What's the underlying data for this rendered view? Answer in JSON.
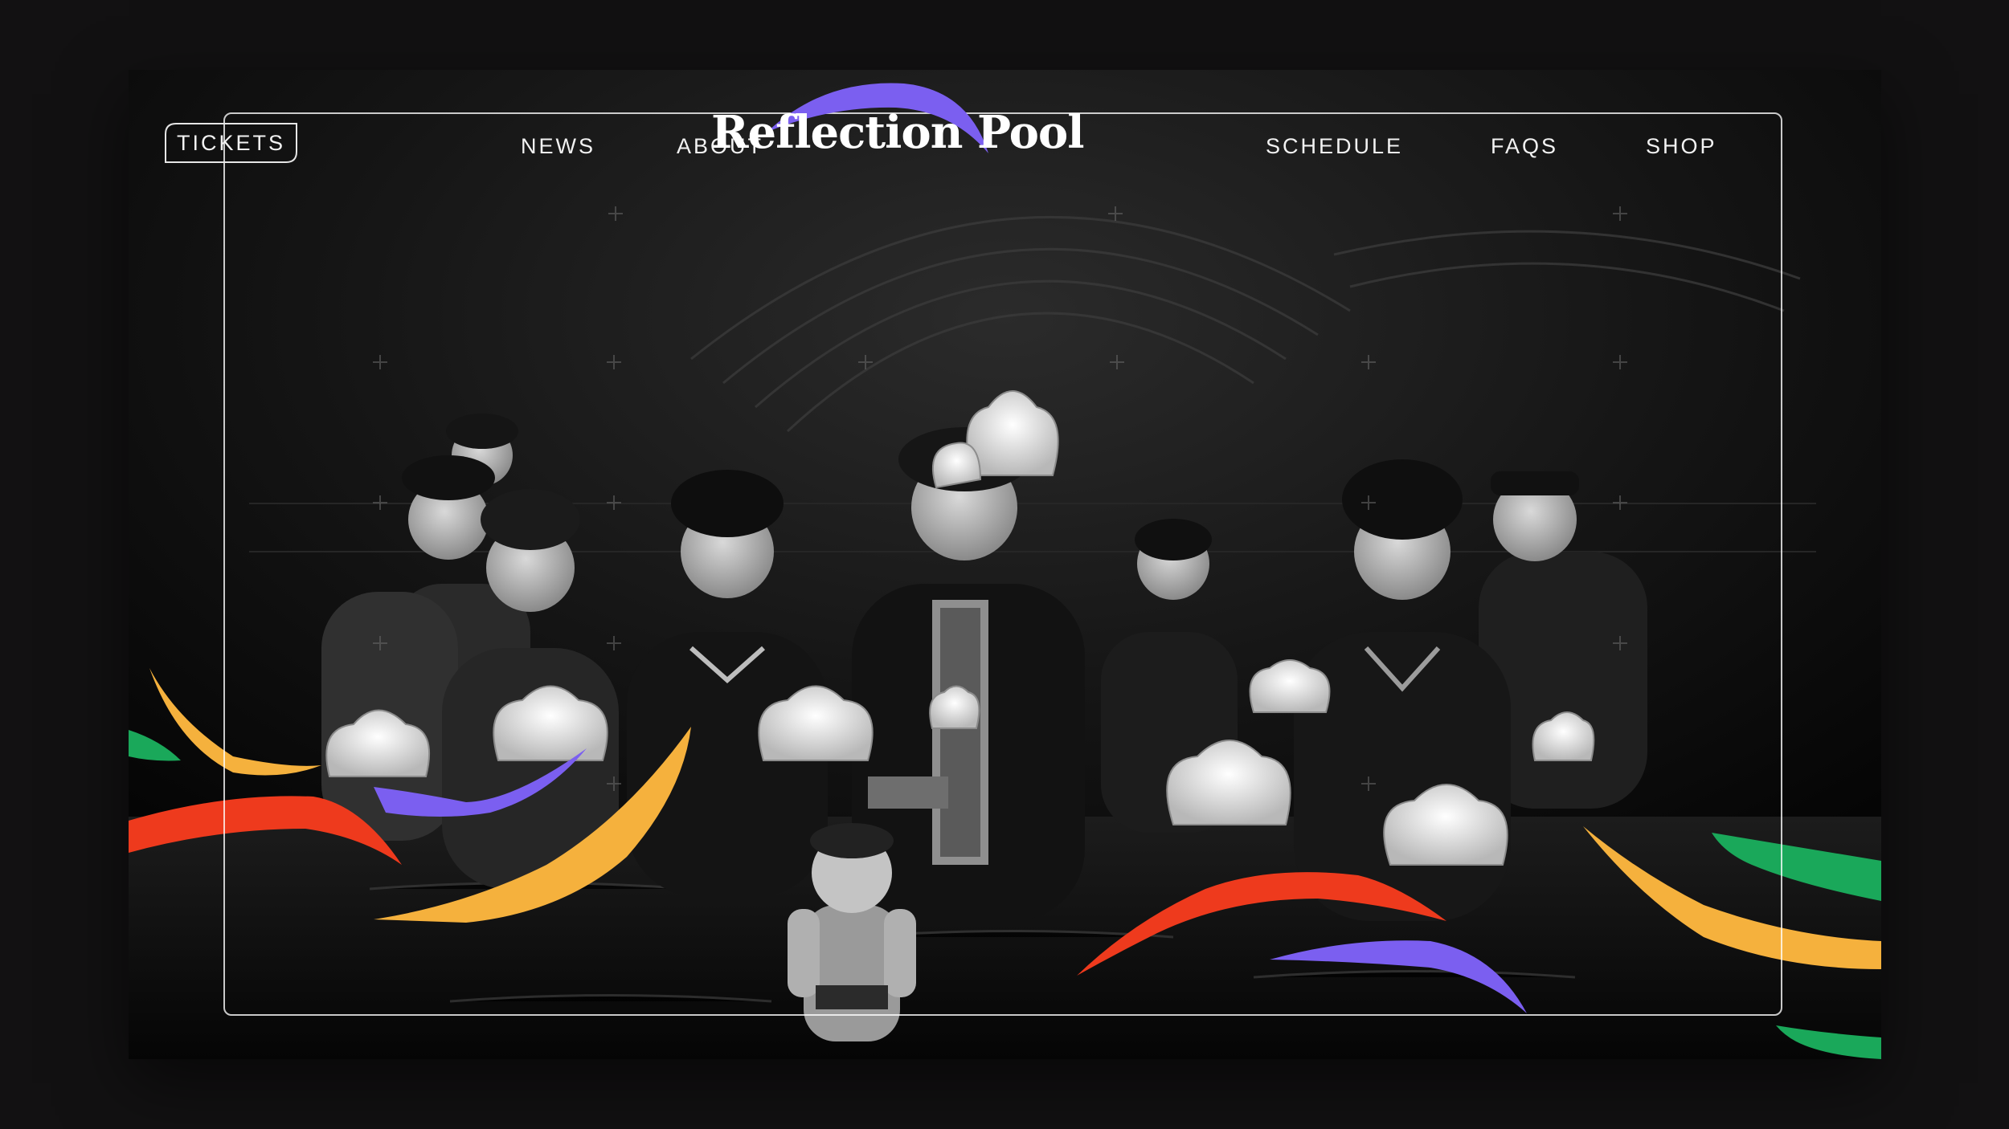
{
  "site": {
    "brand_name": "Reflection Pool",
    "accent_purple": "#7b5ff0",
    "accent_yellow": "#f5b13d",
    "accent_red": "#ee3a1d",
    "accent_green": "#1aa85a"
  },
  "nav": {
    "tickets_label": "TICKETS",
    "left_items": [
      {
        "label": "NEWS"
      },
      {
        "label": "ABOUT"
      }
    ],
    "right_items": [
      {
        "label": "SCHEDULE"
      },
      {
        "label": "FAQS"
      },
      {
        "label": "SHOP"
      }
    ]
  },
  "hero": {
    "image_subject": "water-puppet-performers-photo"
  }
}
